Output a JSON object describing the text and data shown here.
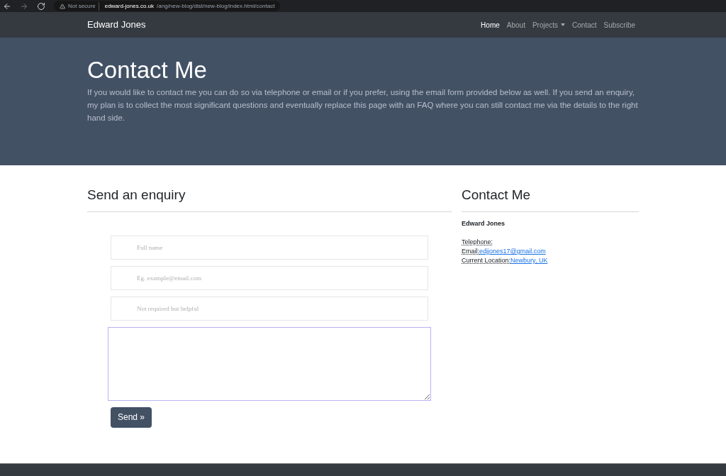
{
  "browser": {
    "security": "Not secure",
    "url_host": "edward-jones.co.uk",
    "url_path": "/ang/new-blog/dist/new-blog/index.html/contact"
  },
  "navbar": {
    "brand": "Edward Jones",
    "items": [
      {
        "label": "Home",
        "selected": true,
        "dropdown": false
      },
      {
        "label": "About",
        "selected": false,
        "dropdown": false
      },
      {
        "label": "Projects",
        "selected": false,
        "dropdown": true
      },
      {
        "label": "Contact",
        "selected": false,
        "dropdown": false
      },
      {
        "label": "Subscribe",
        "selected": false,
        "dropdown": false
      }
    ]
  },
  "hero": {
    "title": "Contact Me",
    "text": "If you would like to contact me you can do so via telephone or email or if you prefer, using the email form provided below as well. If you send an enquiry, my plan is to collect the most significant questions and eventually replace this page with an FAQ where you can still contact me via the details to the right hand side."
  },
  "enquiry": {
    "heading": "Send an enquiry",
    "fields": [
      {
        "placeholder": "Full name"
      },
      {
        "placeholder": "Eg. example@email.com"
      },
      {
        "placeholder": "Not required but helpful"
      }
    ],
    "message": {
      "focused": true
    },
    "button": "Send »"
  },
  "contact": {
    "heading": "Contact Me",
    "name": "Edward Jones",
    "lines": [
      {
        "label": "Telephone:"
      },
      {
        "label": "Email:",
        "link": "edjjones17@gmail.com"
      },
      {
        "label": "Current Location:",
        "link": "Newbury, UK"
      }
    ]
  }
}
